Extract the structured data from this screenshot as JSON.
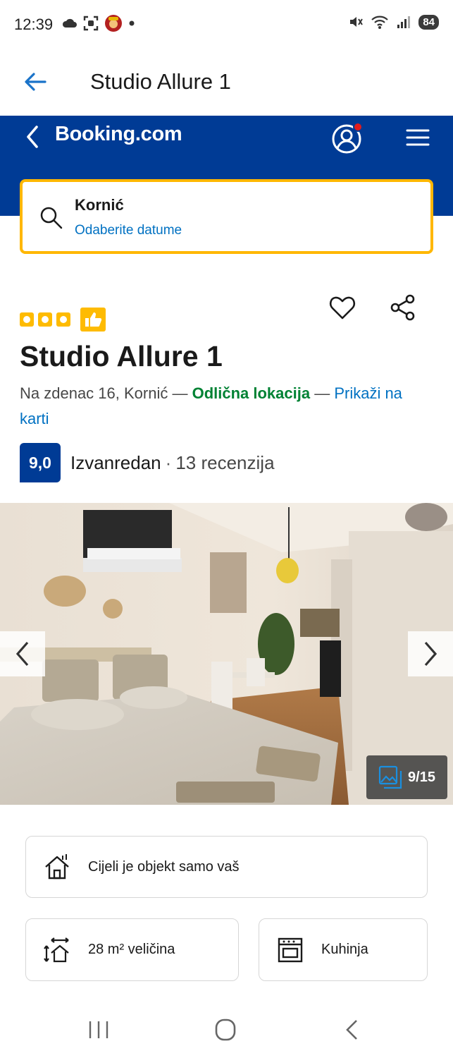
{
  "status_bar": {
    "time": "12:39",
    "battery": "84",
    "left_icons": [
      "cloud-icon",
      "screenshot-icon",
      "app-avatar-icon",
      "dot-icon"
    ],
    "right_icons": [
      "mute-icon",
      "wifi-icon",
      "signal-icon"
    ]
  },
  "app_bar": {
    "title": "Studio Allure 1"
  },
  "booking_header": {
    "logo": "Booking.com",
    "brand_color": "#003b95",
    "accent_color": "#febb02"
  },
  "search": {
    "destination": "Kornić",
    "dates_placeholder": "Odaberite datume"
  },
  "property": {
    "stars": 3,
    "name": "Studio Allure 1",
    "address": "Na zdenac 16, Kornić",
    "separator": " — ",
    "location_label": "Odlična lokacija",
    "map_link": "Prikaži na karti",
    "score": "9,0",
    "score_word": "Izvanredan",
    "score_dot": "·",
    "reviews": "13 recenzija"
  },
  "photo": {
    "counter": "9/15"
  },
  "facilities": [
    {
      "label": "Cijeli je objekt samo vaš",
      "icon": "house-icon"
    },
    {
      "label": "28 m² veličina",
      "icon": "size-icon"
    },
    {
      "label": "Kuhinja",
      "icon": "oven-icon"
    }
  ]
}
